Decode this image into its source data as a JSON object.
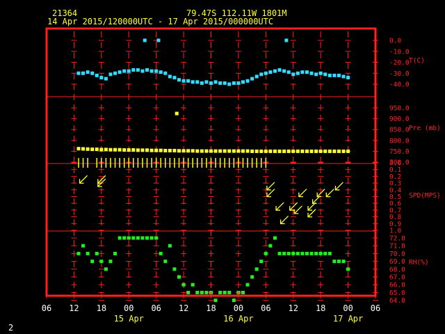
{
  "header": {
    "station_id": "21364",
    "location": "79.47S  112.11W  1801M",
    "time_range": "14 Apr 2015/120000UTC - 17 Apr 2015/000000UTC"
  },
  "footer": {
    "page_number": "2"
  },
  "colors": {
    "frame": "#ff2020",
    "temperature": "#33ddff",
    "pressure": "#ffff33",
    "wind": "#ffff33",
    "humidity": "#22ee22",
    "text": "#ffff33",
    "axis_text": "#ffffff"
  },
  "chart_data": {
    "type": "scatter",
    "x_unit": "hours since 14 Apr 2015 06UTC",
    "x_range": [
      0,
      72
    ],
    "x_tick_labels": [
      "06",
      "12",
      "18",
      "00",
      "06",
      "12",
      "18",
      "00",
      "06",
      "12",
      "18",
      "00",
      "06"
    ],
    "date_labels": [
      {
        "text": "15 Apr",
        "x": 18
      },
      {
        "text": "16 Apr",
        "x": 42
      },
      {
        "text": "17 Apr",
        "x": 66
      }
    ],
    "panels": [
      {
        "name": "T(C)",
        "ticks": [
          "0.0",
          "-10.0",
          "-20.0",
          "-30.0",
          "-40.0"
        ],
        "range": [
          -40,
          0
        ],
        "series": [
          {
            "x": [
              7,
              8,
              9,
              10,
              11,
              12,
              13,
              14,
              15,
              16,
              17,
              18,
              19,
              20,
              21,
              22,
              23,
              24,
              25,
              26,
              27,
              28,
              29,
              30,
              31,
              32,
              33,
              34,
              35,
              36,
              37,
              38,
              39,
              40,
              41,
              42,
              43,
              44,
              45,
              46,
              47,
              48,
              49,
              50,
              51,
              52,
              53,
              54,
              55,
              56,
              57,
              58,
              59,
              60,
              61,
              62,
              63,
              64,
              65,
              66
            ],
            "y": [
              -30,
              -30,
              -29,
              -30,
              -32,
              -34,
              -35,
              -31,
              -30,
              -29,
              -28,
              -28,
              -27,
              -27,
              -28,
              -27,
              -28,
              -28,
              -29,
              -30,
              -33,
              -34,
              -36,
              -37,
              -37,
              -38,
              -38,
              -39,
              -38,
              -39,
              -38,
              -39,
              -39,
              -40,
              -39,
              -39,
              -38,
              -37,
              -35,
              -33,
              -31,
              -30,
              -29,
              -28,
              -27,
              -28,
              -29,
              -31,
              -30,
              -29,
              -29,
              -30,
              -31,
              -30,
              -31,
              -32,
              -32,
              -32,
              -33,
              -34
            ]
          }
        ],
        "outliers": [
          {
            "x": 21.5,
            "y": 0
          },
          {
            "x": 24.5,
            "y": 0
          },
          {
            "x": 52.5,
            "y": 0
          }
        ]
      },
      {
        "name": "Pre (mb)",
        "ticks": [
          "950.0",
          "900.0",
          "850.0",
          "800.0",
          "750.0",
          "700.0"
        ],
        "range": [
          700,
          950
        ],
        "series": [
          {
            "x": [
              7,
              8,
              9,
              10,
              11,
              12,
              13,
              14,
              15,
              16,
              17,
              18,
              19,
              20,
              21,
              22,
              23,
              24,
              25,
              26,
              27,
              28,
              29,
              30,
              31,
              32,
              33,
              34,
              35,
              36,
              37,
              38,
              39,
              40,
              41,
              42,
              43,
              44,
              45,
              46,
              47,
              48,
              49,
              50,
              51,
              52,
              53,
              54,
              55,
              56,
              57,
              58,
              59,
              60,
              61,
              62,
              63,
              64,
              65,
              66
            ],
            "y": [
              762,
              761,
              760,
              759,
              759,
              758,
              758,
              757,
              757,
              757,
              756,
              756,
              756,
              755,
              755,
              755,
              754,
              754,
              754,
              753,
              753,
              753,
              752,
              752,
              752,
              752,
              751,
              751,
              751,
              751,
              751,
              751,
              751,
              751,
              751,
              751,
              751,
              751,
              750,
              750,
              750,
              750,
              750,
              750,
              750,
              750,
              750,
              750,
              750,
              750,
              750,
              750,
              750,
              750,
              750,
              750,
              750,
              750,
              750,
              750
            ]
          }
        ],
        "outliers": [
          {
            "x": 28.5,
            "y": 924
          }
        ]
      },
      {
        "name": "SPD(MPS)",
        "ticks": [
          "0.0",
          "0.1",
          "0.2",
          "0.3",
          "0.4",
          "0.5",
          "0.6",
          "0.7",
          "0.8",
          "0.9",
          "1.0"
        ],
        "range": [
          0,
          1.0
        ],
        "calm_marks_x": [
          7,
          8,
          9,
          11,
          12,
          13,
          14,
          15,
          16,
          17,
          18,
          19,
          20,
          21,
          22,
          23,
          24,
          25,
          26,
          27,
          28,
          29,
          30,
          31,
          32,
          33,
          34,
          35,
          36,
          37,
          38,
          39,
          40,
          41,
          42,
          43,
          44,
          45,
          46,
          47,
          48
        ],
        "arrows": [
          {
            "x": 8,
            "y": 0.25
          },
          {
            "x": 12,
            "y": 0.3
          },
          {
            "x": 12,
            "y": 0.25
          },
          {
            "x": 49,
            "y": 0.35
          },
          {
            "x": 49,
            "y": 0.45
          },
          {
            "x": 51,
            "y": 0.65
          },
          {
            "x": 52,
            "y": 0.85
          },
          {
            "x": 54,
            "y": 0.65
          },
          {
            "x": 55,
            "y": 0.7
          },
          {
            "x": 56,
            "y": 0.45
          },
          {
            "x": 58,
            "y": 0.65
          },
          {
            "x": 58,
            "y": 0.75
          },
          {
            "x": 59,
            "y": 0.55
          },
          {
            "x": 60,
            "y": 0.45
          },
          {
            "x": 62,
            "y": 0.45
          },
          {
            "x": 64,
            "y": 0.35
          }
        ]
      },
      {
        "name": "RH(%)",
        "ticks": [
          "72.0",
          "71.0",
          "70.0",
          "69.0",
          "68.0",
          "67.0",
          "66.0",
          "65.0",
          "64.0"
        ],
        "range": [
          64,
          72
        ],
        "series": [
          {
            "x": [
              7,
              8,
              9,
              10,
              11,
              12,
              13,
              14,
              15,
              16,
              17,
              18,
              19,
              20,
              21,
              22,
              23,
              24,
              25,
              26,
              27,
              28,
              29,
              30,
              31,
              32,
              33,
              34,
              35,
              36,
              37,
              38,
              39,
              40,
              41,
              42,
              43,
              44,
              45,
              46,
              47,
              48,
              49,
              50,
              51,
              52,
              53,
              54,
              55,
              56,
              57,
              58,
              59,
              60,
              61,
              62,
              63,
              64,
              65,
              66
            ],
            "y": [
              70,
              71,
              70,
              69,
              70,
              69,
              68,
              69,
              70,
              72,
              72,
              72,
              72,
              72,
              72,
              72,
              72,
              72,
              70,
              69,
              71,
              68,
              67,
              66,
              65,
              66,
              65,
              65,
              65,
              65,
              64,
              65,
              65,
              65,
              64,
              65,
              65,
              66,
              67,
              68,
              69,
              70,
              71,
              72,
              70,
              70,
              70,
              70,
              70,
              70,
              70,
              70,
              70,
              70,
              70,
              70,
              69,
              69,
              69,
              68
            ]
          }
        ]
      }
    ]
  }
}
